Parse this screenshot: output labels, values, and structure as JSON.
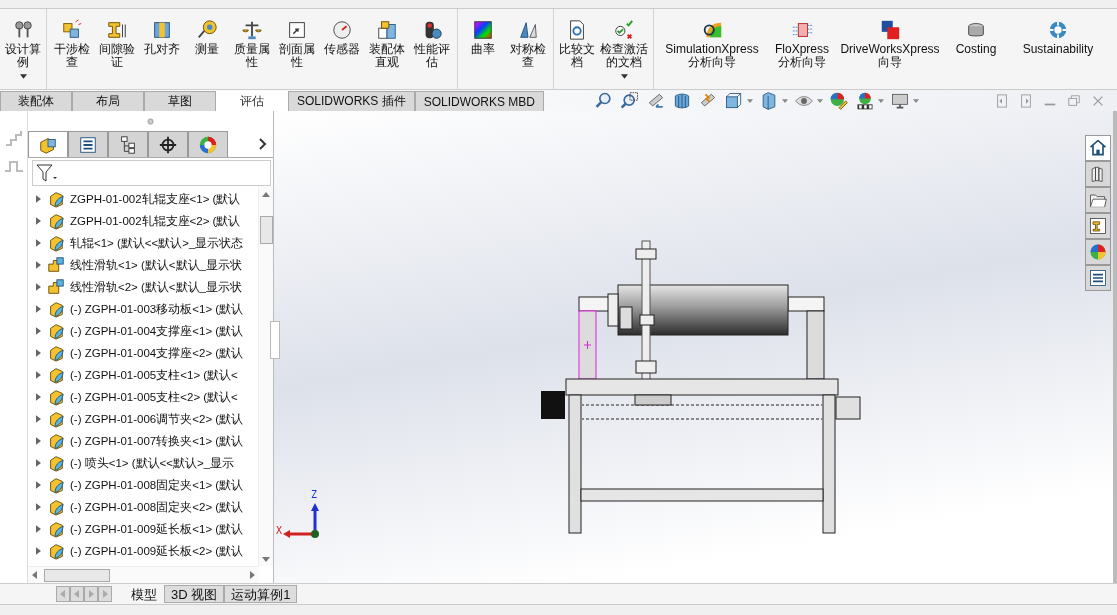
{
  "ribbon": {
    "groups": [
      {
        "buttons": [
          {
            "lines": [
              "设计算",
              "例"
            ],
            "dropdown": true
          }
        ]
      },
      {
        "buttons": [
          {
            "lines": [
              "干涉检",
              "查"
            ],
            "dropdown": false
          },
          {
            "lines": [
              "间隙验",
              "证"
            ],
            "dropdown": false
          },
          {
            "lines": [
              "孔对齐"
            ],
            "dropdown": false
          },
          {
            "lines": [
              "测量"
            ],
            "dropdown": false
          },
          {
            "lines": [
              "质量属",
              "性"
            ],
            "dropdown": false
          },
          {
            "lines": [
              "剖面属",
              "性"
            ],
            "dropdown": false
          },
          {
            "lines": [
              "传感器"
            ],
            "dropdown": false
          },
          {
            "lines": [
              "装配体",
              "直观"
            ],
            "dropdown": false
          },
          {
            "lines": [
              "性能评",
              "估"
            ],
            "dropdown": false
          }
        ]
      },
      {
        "buttons": [
          {
            "lines": [
              "曲率"
            ],
            "dropdown": false
          },
          {
            "lines": [
              "对称检",
              "查"
            ],
            "dropdown": false
          }
        ]
      },
      {
        "buttons": [
          {
            "lines": [
              "比较文",
              "档"
            ],
            "dropdown": false
          },
          {
            "lines": [
              "检查激活",
              "的文档"
            ],
            "dropdown": true
          }
        ]
      },
      {
        "buttons": [
          {
            "lines": [
              "SimulationXpress",
              "分析向导"
            ],
            "dropdown": false
          },
          {
            "lines": [
              "FloXpress",
              "分析向导"
            ],
            "dropdown": false
          },
          {
            "lines": [
              "DriveWorksXpress",
              "向导"
            ],
            "dropdown": false
          },
          {
            "lines": [
              "Costing"
            ],
            "dropdown": false
          },
          {
            "lines": [
              "Sustainability"
            ],
            "dropdown": false
          }
        ]
      }
    ]
  },
  "tabs": [
    {
      "label": "装配体",
      "selected": false
    },
    {
      "label": "布局",
      "selected": false
    },
    {
      "label": "草图",
      "selected": false
    },
    {
      "label": "评估",
      "selected": true
    },
    {
      "label": "SOLIDWORKS 插件",
      "selected": false
    },
    {
      "label": "SOLIDWORKS MBD",
      "selected": false
    }
  ],
  "panel_tabs": [
    {
      "selected": true
    },
    {
      "selected": false
    },
    {
      "selected": false
    },
    {
      "selected": false
    },
    {
      "selected": false
    }
  ],
  "tree": [
    {
      "kind": "part",
      "text": "ZGPH-01-002轧辊支座<1> (默认"
    },
    {
      "kind": "part",
      "text": "ZGPH-01-002轧辊支座<2> (默认"
    },
    {
      "kind": "part",
      "text": "轧辊<1> (默认<<默认>_显示状态"
    },
    {
      "kind": "assembly",
      "text": "线性滑轨<1> (默认<默认_显示状"
    },
    {
      "kind": "assembly",
      "text": "线性滑轨<2> (默认<默认_显示状"
    },
    {
      "kind": "part",
      "text": "(-) ZGPH-01-003移动板<1> (默认"
    },
    {
      "kind": "part",
      "text": "(-) ZGPH-01-004支撑座<1> (默认"
    },
    {
      "kind": "part",
      "text": "(-) ZGPH-01-004支撑座<2> (默认"
    },
    {
      "kind": "part",
      "text": "(-) ZGPH-01-005支柱<1> (默认<"
    },
    {
      "kind": "part",
      "text": "(-) ZGPH-01-005支柱<2> (默认<"
    },
    {
      "kind": "part",
      "text": "(-) ZGPH-01-006调节夹<2> (默认"
    },
    {
      "kind": "part",
      "text": "(-) ZGPH-01-007转换夹<1> (默认"
    },
    {
      "kind": "part",
      "text": "(-) 喷头<1> (默认<<默认>_显示"
    },
    {
      "kind": "part",
      "text": "(-) ZGPH-01-008固定夹<1> (默认"
    },
    {
      "kind": "part",
      "text": "(-) ZGPH-01-008固定夹<2> (默认"
    },
    {
      "kind": "part",
      "text": "(-) ZGPH-01-009延长板<1> (默认"
    },
    {
      "kind": "part",
      "text": "(-) ZGPH-01-009延长板<2> (默认"
    }
  ],
  "bottom_tabs": [
    {
      "label": "模型",
      "selected": true
    },
    {
      "label": "3D 视图",
      "selected": false
    },
    {
      "label": "运动算例1",
      "selected": false
    }
  ],
  "triad": {
    "x": "X",
    "z": "Z"
  }
}
